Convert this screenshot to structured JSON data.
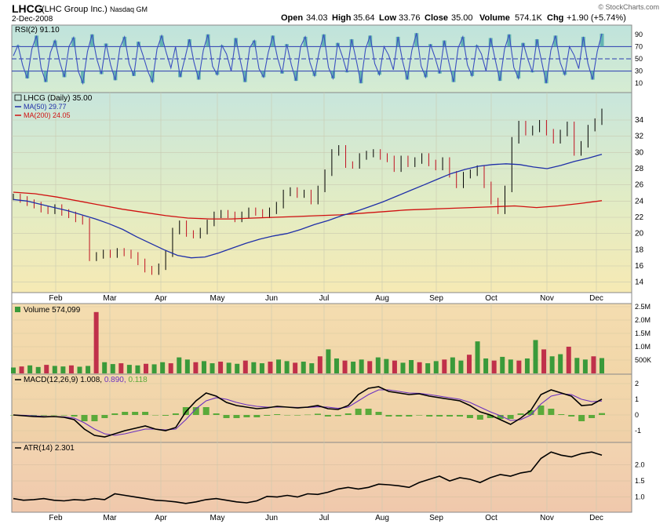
{
  "header": {
    "symbol": "LHCG",
    "company": "(LHC Group Inc.)",
    "exchange": "Nasdaq GM",
    "date": "2-Dec-2008",
    "open_label": "Open",
    "open": "34.03",
    "high_label": "High",
    "high": "35.64",
    "low_label": "Low",
    "low": "33.76",
    "close_label": "Close",
    "close": "35.00",
    "volume_label": "Volume",
    "volume": "574.1K",
    "chg_label": "Chg",
    "chg": "+1.90 (+5.74%)",
    "watermark": "© StockCharts.com"
  },
  "colors": {
    "price_line": "#000000",
    "ma50": "#1f2fa8",
    "ma200": "#d01010",
    "rsi_line": "#3a4fc0",
    "rsi_fill": "#4aa8a8",
    "vol_up": "#3a9a3a",
    "vol_down": "#c0304a",
    "macd_line": "#000000",
    "signal_line": "#6a2fc0",
    "hist": "#5aaa3a",
    "atr_line": "#000000"
  },
  "chart_data": [
    {
      "type": "line",
      "panel": "RSI",
      "label": "RSI(2) 91.10",
      "ylim": [
        0,
        100
      ],
      "y_ticks": [
        10,
        30,
        50,
        70,
        90
      ],
      "bands": [
        30,
        70
      ],
      "series": [
        {
          "name": "RSI(2)",
          "values": [
            55,
            72,
            40,
            18,
            66,
            88,
            35,
            12,
            60,
            80,
            45,
            20,
            70,
            85,
            30,
            10,
            62,
            90,
            50,
            25,
            75,
            40,
            15,
            68,
            86,
            42,
            22,
            78,
            55,
            30,
            12,
            66,
            88,
            60,
            35,
            70,
            20,
            50,
            82,
            44,
            16,
            64,
            90,
            38,
            24,
            72,
            58,
            30,
            84,
            46,
            12,
            68,
            80,
            34,
            20,
            60,
            88,
            52,
            26,
            74,
            40,
            14,
            70,
            86,
            44,
            22,
            62,
            90,
            36,
            18,
            76,
            54,
            28,
            82,
            48,
            10,
            66,
            88,
            42,
            24,
            70,
            56,
            32,
            86,
            46,
            16,
            64,
            92,
            38,
            20,
            74,
            52,
            26,
            80,
            44,
            12,
            68,
            86,
            40,
            22,
            72,
            58,
            30,
            84,
            48,
            14,
            66,
            90,
            36,
            18,
            76,
            50,
            28,
            82,
            46,
            10,
            64,
            88,
            44,
            24,
            70,
            56,
            34,
            86,
            42,
            16,
            62,
            91.1
          ]
        }
      ]
    },
    {
      "type": "line",
      "panel": "Price",
      "title": "LHCG (Daily) 35.00",
      "x": [
        "Feb",
        "Mar",
        "Apr",
        "May",
        "Jun",
        "Jul",
        "Aug",
        "Sep",
        "Oct",
        "Nov",
        "Dec"
      ],
      "ylim": [
        13,
        37
      ],
      "y_ticks": [
        14,
        16,
        18,
        20,
        22,
        24,
        26,
        28,
        30,
        32,
        34
      ],
      "series": [
        {
          "name": "LHCG (Daily) 35.00",
          "values": [
            24.5,
            24.2,
            23.8,
            23.5,
            23.0,
            22.8,
            23.2,
            22.6,
            22.3,
            21.8,
            21.5,
            17.0,
            17.3,
            17.6,
            17.4,
            17.8,
            17.6,
            17.3,
            16.5,
            15.6,
            15.3,
            15.9,
            17.5,
            20.3,
            21.2,
            20.0,
            19.8,
            20.3,
            21.3,
            22.3,
            22.5,
            22.3,
            21.8,
            22.3,
            22.8,
            22.6,
            22.3,
            22.8,
            23.5,
            25.0,
            25.3,
            24.8,
            25.0,
            24.0,
            25.5,
            27.5,
            30.0,
            30.5,
            28.5,
            28.4,
            29.5,
            29.8,
            30.0,
            29.5,
            29.2,
            28.0,
            29.2,
            28.6,
            29.0,
            29.5,
            28.7,
            28.2,
            29.0,
            27.3,
            26.0,
            27.2,
            27.5,
            28.0,
            26.0,
            24.0,
            22.8,
            25.5,
            31.5,
            33.5,
            32.5,
            32.9,
            33.6,
            32.5,
            31.5,
            32.4,
            33.4,
            30.0,
            31.0,
            33.0,
            33.8,
            35.0
          ]
        },
        {
          "name": "MA(50) 29.77",
          "values": [
            24.2,
            24.0,
            23.6,
            23.2,
            22.8,
            22.3,
            21.8,
            21.2,
            20.5,
            19.6,
            18.8,
            18.0,
            17.3,
            17.0,
            17.1,
            17.6,
            18.2,
            18.8,
            19.3,
            19.7,
            20.0,
            20.5,
            21.1,
            21.6,
            22.2,
            22.7,
            23.3,
            23.9,
            24.6,
            25.3,
            26.0,
            26.7,
            27.4,
            27.9,
            28.3,
            28.5,
            28.6,
            28.5,
            28.2,
            28.0,
            28.4,
            28.9,
            29.3,
            29.77
          ]
        },
        {
          "name": "MA(200) 24.05",
          "values": [
            25.1,
            24.9,
            24.5,
            24.0,
            23.5,
            23.0,
            22.6,
            22.2,
            21.9,
            21.8,
            21.8,
            21.9,
            22.0,
            22.1,
            22.2,
            22.3,
            22.5,
            22.7,
            22.9,
            23.0,
            23.1,
            23.2,
            23.3,
            23.4,
            23.2,
            23.4,
            23.7,
            24.05
          ]
        }
      ]
    },
    {
      "type": "bar",
      "panel": "Volume",
      "label": "Volume 574,099",
      "ylim": [
        0,
        2500000
      ],
      "y_ticks": [
        "2.5M",
        "2.0M",
        "1.5M",
        "1.0M",
        "500K"
      ],
      "values": [
        220000,
        260000,
        300000,
        240000,
        320000,
        280000,
        260000,
        300000,
        250000,
        280000,
        2300000,
        420000,
        350000,
        380000,
        320000,
        300000,
        360000,
        340000,
        420000,
        380000,
        600000,
        520000,
        420000,
        460000,
        380000,
        440000,
        400000,
        360000,
        480000,
        420000,
        380000,
        440000,
        520000,
        460000,
        400000,
        440000,
        380000,
        640000,
        900000,
        560000,
        480000,
        440000,
        520000,
        460000,
        600000,
        540000,
        480000,
        400000,
        500000,
        420000,
        380000,
        460000,
        520000,
        600000,
        480000,
        700000,
        1200000,
        560000,
        480000,
        620000,
        520000,
        480000,
        560000,
        1250000,
        900000,
        640000,
        720000,
        1000000,
        580000,
        520000,
        640000,
        574099
      ]
    },
    {
      "type": "line",
      "panel": "MACD",
      "label": "MACD(12,26,9) 1.008, 0.890, 0.118",
      "ylim": [
        -1.6,
        2.4
      ],
      "y_ticks": [
        2,
        1,
        0,
        -1
      ],
      "series": [
        {
          "name": "MACD",
          "values": [
            0.0,
            -0.05,
            -0.1,
            -0.12,
            -0.1,
            -0.15,
            -0.3,
            -0.9,
            -1.3,
            -1.4,
            -1.2,
            -1.0,
            -0.85,
            -0.7,
            -0.9,
            -1.0,
            -0.8,
            0.2,
            0.9,
            1.4,
            1.2,
            0.8,
            0.6,
            0.5,
            0.4,
            0.45,
            0.55,
            0.5,
            0.45,
            0.5,
            0.6,
            0.4,
            0.35,
            0.6,
            1.3,
            1.7,
            1.8,
            1.5,
            1.4,
            1.3,
            1.35,
            1.2,
            1.1,
            1.0,
            0.9,
            0.6,
            0.2,
            0.0,
            -0.3,
            -0.6,
            -0.2,
            0.3,
            1.3,
            1.6,
            1.4,
            1.2,
            0.6,
            0.65,
            1.008
          ]
        },
        {
          "name": "Signal",
          "values": [
            0.0,
            -0.02,
            -0.06,
            -0.09,
            -0.1,
            -0.12,
            -0.2,
            -0.5,
            -0.9,
            -1.2,
            -1.3,
            -1.2,
            -1.05,
            -0.9,
            -0.9,
            -0.95,
            -0.9,
            -0.3,
            0.4,
            0.9,
            1.1,
            1.0,
            0.8,
            0.65,
            0.55,
            0.5,
            0.5,
            0.5,
            0.48,
            0.48,
            0.52,
            0.5,
            0.42,
            0.5,
            0.9,
            1.3,
            1.6,
            1.6,
            1.5,
            1.4,
            1.38,
            1.3,
            1.2,
            1.1,
            1.0,
            0.8,
            0.5,
            0.2,
            -0.05,
            -0.35,
            -0.3,
            0.0,
            0.7,
            1.2,
            1.35,
            1.3,
            1.0,
            0.85,
            0.89
          ]
        },
        {
          "name": "Histogram",
          "values": [
            0.0,
            -0.03,
            -0.04,
            -0.03,
            0.0,
            -0.03,
            -0.1,
            -0.4,
            -0.4,
            -0.2,
            0.1,
            0.2,
            0.2,
            0.2,
            0.0,
            -0.05,
            0.1,
            0.5,
            0.5,
            0.5,
            0.1,
            -0.2,
            -0.2,
            -0.15,
            -0.15,
            -0.05,
            0.05,
            0.0,
            -0.03,
            0.02,
            0.08,
            -0.1,
            -0.07,
            0.1,
            0.4,
            0.4,
            0.2,
            -0.1,
            -0.1,
            -0.1,
            -0.03,
            -0.1,
            -0.1,
            -0.1,
            -0.1,
            -0.2,
            -0.3,
            -0.2,
            -0.25,
            -0.25,
            0.1,
            0.3,
            0.6,
            0.4,
            0.05,
            -0.1,
            -0.4,
            -0.2,
            0.118
          ]
        }
      ]
    },
    {
      "type": "line",
      "panel": "ATR",
      "label": "ATR(14) 2.301",
      "ylim": [
        0.6,
        2.6
      ],
      "y_ticks": [
        2.0,
        1.5,
        1.0
      ],
      "series": [
        {
          "name": "ATR(14)",
          "values": [
            0.95,
            0.9,
            0.92,
            0.95,
            0.9,
            0.88,
            0.92,
            0.9,
            0.95,
            0.92,
            1.1,
            1.05,
            1.0,
            0.95,
            0.9,
            0.88,
            0.85,
            0.8,
            0.85,
            0.92,
            0.95,
            0.9,
            0.85,
            0.82,
            0.88,
            1.02,
            1.0,
            1.05,
            1.0,
            1.1,
            1.08,
            1.15,
            1.25,
            1.3,
            1.25,
            1.3,
            1.4,
            1.38,
            1.35,
            1.3,
            1.45,
            1.55,
            1.65,
            1.5,
            1.6,
            1.55,
            1.45,
            1.6,
            1.7,
            1.65,
            1.75,
            1.8,
            2.2,
            2.4,
            2.3,
            2.25,
            2.35,
            2.4,
            2.301
          ]
        }
      ]
    }
  ]
}
